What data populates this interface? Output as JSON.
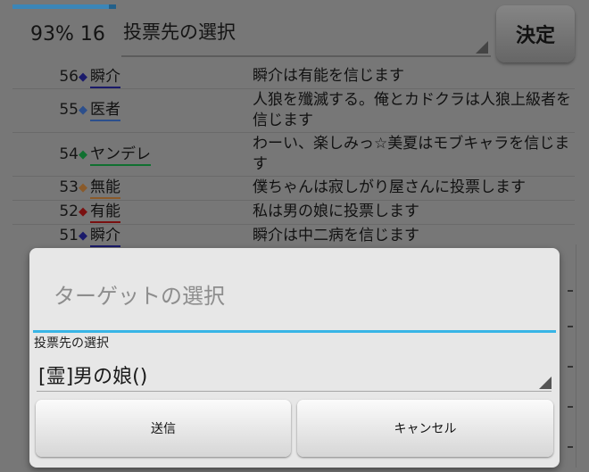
{
  "header": {
    "progress_fraction": 0.93,
    "status": "93% 16",
    "vote_select_label": "投票先の選択",
    "decide_button": "決定"
  },
  "log": [
    {
      "num": "56",
      "diamond": "◆",
      "diamond_color": "#1a1a6a",
      "name": "瞬介",
      "underline": "#1a1a6a",
      "message": "瞬介は有能を信じます"
    },
    {
      "num": "55",
      "diamond": "◆",
      "diamond_color": "#2c4f8c",
      "name": "医者",
      "underline": "#2c4f8c",
      "message": "人狼を殲滅する。俺とカドクラは人狼上級者を信じます"
    },
    {
      "num": "54",
      "diamond": "◆",
      "diamond_color": "#107030",
      "name": "ヤンデレ",
      "underline": "#107030",
      "message": "わーい、楽しみっ☆美夏はモブキャラを信じます"
    },
    {
      "num": "53",
      "diamond": "◆",
      "diamond_color": "#8a5a2a",
      "name": "無能",
      "underline": "#8a5a2a",
      "message": "僕ちゃんは寂しがり屋さんに投票します"
    },
    {
      "num": "52",
      "diamond": "◆",
      "diamond_color": "#7a1010",
      "name": "有能",
      "underline": "#7a1010",
      "message": "私は男の娘に投票します"
    },
    {
      "num": "51",
      "diamond": "◆",
      "diamond_color": "#1a1a6a",
      "name": "瞬介",
      "underline": "#1a1a6a",
      "message": "瞬介は中二病を信じます"
    }
  ],
  "dialog": {
    "title": "ターゲットの選択",
    "field_label": "投票先の選択",
    "selected_value": "[霊]男の娘()",
    "send_button": "送信",
    "cancel_button": "キャンセル"
  },
  "colors": {
    "dialog_accent": "#38b5e6",
    "progress": "#3b86b8"
  }
}
